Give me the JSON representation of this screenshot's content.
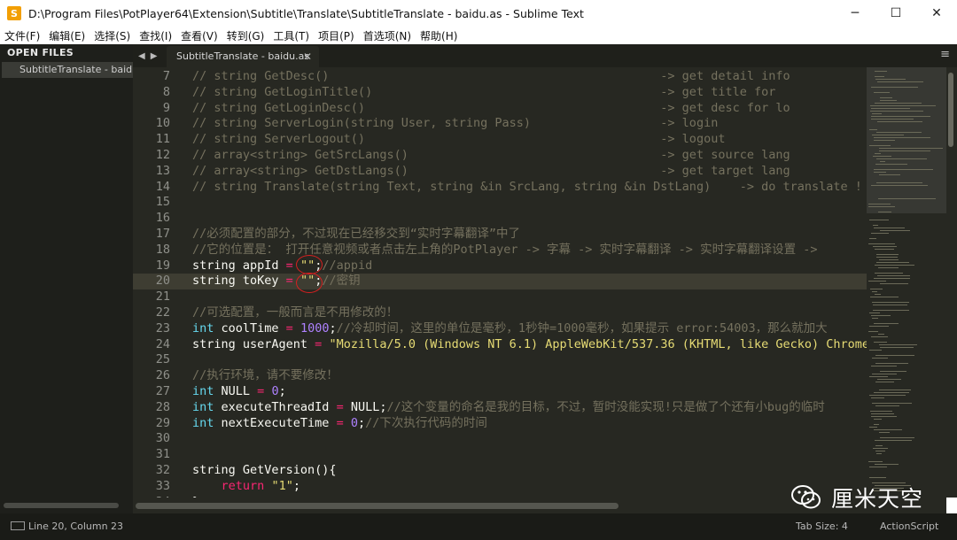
{
  "window": {
    "title": "D:\\Program Files\\PotPlayer64\\Extension\\Subtitle\\Translate\\SubtitleTranslate - baidu.as - Sublime Text",
    "app_icon_letter": "S",
    "minimize": "─",
    "maximize": "☐",
    "close": "✕"
  },
  "menu": [
    "文件(F)",
    "编辑(E)",
    "选择(S)",
    "查找(I)",
    "查看(V)",
    "转到(G)",
    "工具(T)",
    "项目(P)",
    "首选项(N)",
    "帮助(H)"
  ],
  "sidebar": {
    "header": "OPEN FILES",
    "files": [
      "SubtitleTranslate - baidu.as"
    ]
  },
  "tabs": {
    "nav_prev": "◀",
    "nav_next": "▶",
    "active": "SubtitleTranslate - baidu.as",
    "close": "✕",
    "menu": "≡"
  },
  "editor": {
    "current_line": 20,
    "lines": [
      {
        "n": "7",
        "segs": [
          [
            "c-com",
            "// string GetDesc()                                              -> get detail info"
          ]
        ]
      },
      {
        "n": "8",
        "segs": [
          [
            "c-com",
            "// string GetLoginTitle()                                        -> get title for"
          ]
        ]
      },
      {
        "n": "9",
        "segs": [
          [
            "c-com",
            "// string GetLoginDesc()                                         -> get desc for lo"
          ]
        ]
      },
      {
        "n": "10",
        "segs": [
          [
            "c-com",
            "// string ServerLogin(string User, string Pass)                  -> login"
          ]
        ]
      },
      {
        "n": "11",
        "segs": [
          [
            "c-com",
            "// string ServerLogout()                                         -> logout"
          ]
        ]
      },
      {
        "n": "12",
        "segs": [
          [
            "c-com",
            "// array<string> GetSrcLangs()                                   -> get source lang"
          ]
        ]
      },
      {
        "n": "13",
        "segs": [
          [
            "c-com",
            "// array<string> GetDstLangs()                                   -> get target lang"
          ]
        ]
      },
      {
        "n": "14",
        "segs": [
          [
            "c-com",
            "// string Translate(string Text, string &in SrcLang, string &in DstLang)    -> do translate !"
          ]
        ]
      },
      {
        "n": "15",
        "segs": []
      },
      {
        "n": "16",
        "segs": []
      },
      {
        "n": "17",
        "segs": [
          [
            "c-com",
            "//必须配置的部分，不过现在已经移交到“实时字幕翻译”中了"
          ]
        ]
      },
      {
        "n": "18",
        "segs": [
          [
            "c-com",
            "//它的位置是： 打开任意视频或者点击左上角的PotPlayer -> 字幕 -> 实时字幕翻译 -> 实时字幕翻译设置 -> "
          ]
        ]
      },
      {
        "n": "19",
        "segs": [
          [
            "c-txt",
            "string appId "
          ],
          [
            "c-op",
            "="
          ],
          [
            "c-txt",
            " "
          ],
          [
            "c-str",
            "\"\""
          ],
          [
            "c-txt",
            ";"
          ],
          [
            "c-com",
            "//appid"
          ]
        ]
      },
      {
        "n": "20",
        "segs": [
          [
            "c-txt",
            "string toKey "
          ],
          [
            "c-op",
            "="
          ],
          [
            "c-txt",
            " "
          ],
          [
            "c-str",
            "\"\""
          ],
          [
            "c-txt",
            ";"
          ],
          [
            "c-com",
            "//密钥"
          ]
        ]
      },
      {
        "n": "21",
        "segs": []
      },
      {
        "n": "22",
        "segs": [
          [
            "c-com",
            "//可选配置，一般而言是不用修改的！"
          ]
        ]
      },
      {
        "n": "23",
        "segs": [
          [
            "c-type",
            "int"
          ],
          [
            "c-txt",
            " coolTime "
          ],
          [
            "c-op",
            "="
          ],
          [
            "c-txt",
            " "
          ],
          [
            "c-num",
            "1000"
          ],
          [
            "c-txt",
            ";"
          ],
          [
            "c-com",
            "//冷却时间，这里的单位是毫秒，1秒钟=1000毫秒，如果提示 error:54003，那么就加大"
          ]
        ]
      },
      {
        "n": "24",
        "segs": [
          [
            "c-txt",
            "string userAgent "
          ],
          [
            "c-op",
            "="
          ],
          [
            "c-txt",
            " "
          ],
          [
            "c-str",
            "\"Mozilla/5.0 (Windows NT 6.1) AppleWebKit/537.36 (KHTML, like Gecko) Chrome/"
          ]
        ]
      },
      {
        "n": "25",
        "segs": []
      },
      {
        "n": "26",
        "segs": [
          [
            "c-com",
            "//执行环境，请不要修改！"
          ]
        ]
      },
      {
        "n": "27",
        "segs": [
          [
            "c-type",
            "int"
          ],
          [
            "c-txt",
            " NULL "
          ],
          [
            "c-op",
            "="
          ],
          [
            "c-txt",
            " "
          ],
          [
            "c-num",
            "0"
          ],
          [
            "c-txt",
            ";"
          ]
        ]
      },
      {
        "n": "28",
        "segs": [
          [
            "c-type",
            "int"
          ],
          [
            "c-txt",
            " executeThreadId "
          ],
          [
            "c-op",
            "="
          ],
          [
            "c-txt",
            " NULL;"
          ],
          [
            "c-com",
            "//这个变量的命名是我的目标，不过，暂时没能实现!只是做了个还有小bug的临时"
          ]
        ]
      },
      {
        "n": "29",
        "segs": [
          [
            "c-type",
            "int"
          ],
          [
            "c-txt",
            " nextExecuteTime "
          ],
          [
            "c-op",
            "="
          ],
          [
            "c-txt",
            " "
          ],
          [
            "c-num",
            "0"
          ],
          [
            "c-txt",
            ";"
          ],
          [
            "c-com",
            "//下次执行代码的时间"
          ]
        ]
      },
      {
        "n": "30",
        "segs": []
      },
      {
        "n": "31",
        "segs": []
      },
      {
        "n": "32",
        "segs": [
          [
            "c-txt",
            "string GetVersion(){"
          ]
        ]
      },
      {
        "n": "33",
        "segs": [
          [
            "c-txt",
            "    "
          ],
          [
            "c-kw",
            "return"
          ],
          [
            "c-txt",
            " "
          ],
          [
            "c-str",
            "\"1\""
          ],
          [
            "c-txt",
            ";"
          ]
        ]
      },
      {
        "n": "34",
        "segs": [
          [
            "c-txt",
            "}"
          ]
        ]
      }
    ]
  },
  "statusbar": {
    "position": "Line 20, Column 23",
    "tab_size": "Tab Size: 4",
    "syntax": "ActionScript"
  },
  "watermark": {
    "text": "厘米天空",
    "icon": "wechat-icon"
  },
  "colors": {
    "editor_bg": "#272822",
    "comment": "#75715e",
    "keyword": "#f92672",
    "type": "#66d9ef",
    "number": "#ae81ff",
    "string": "#e6db74",
    "annotation_circle": "#d62020"
  }
}
